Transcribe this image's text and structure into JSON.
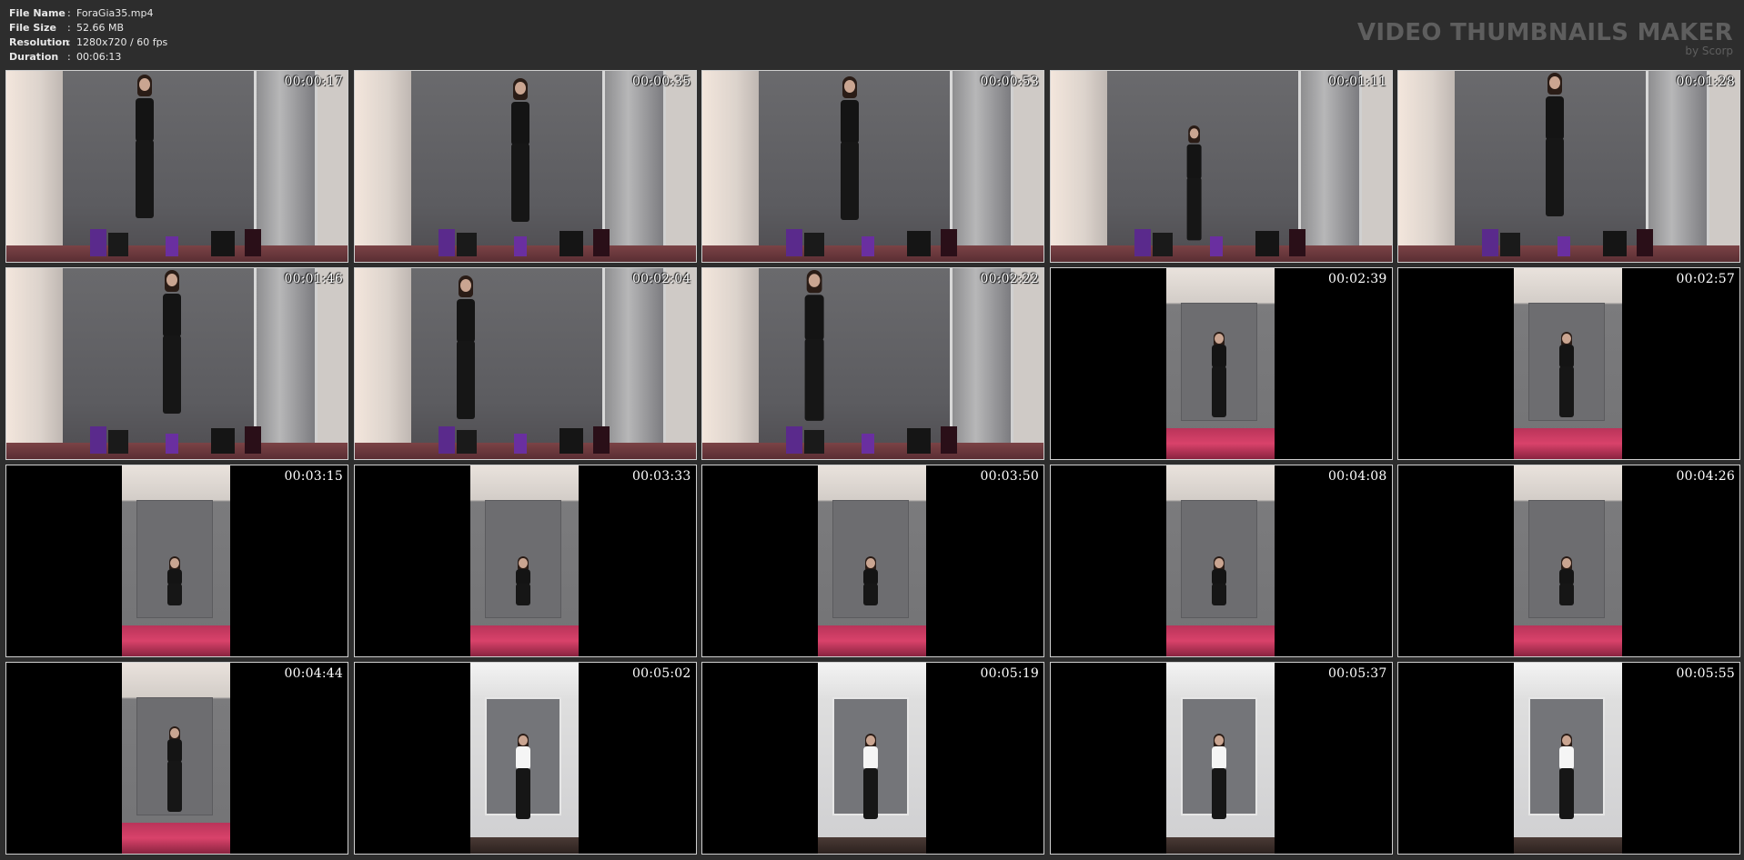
{
  "header": {
    "file_name_label": "File Name",
    "file_name": "ForaGia35.mp4",
    "file_size_label": "File Size",
    "file_size": "52.66 MB",
    "resolution_label": "Resolution",
    "resolution": "1280x720 / 60 fps",
    "duration_label": "Duration",
    "duration": "00:06:13",
    "separator": ":",
    "brand_title": "VIDEO THUMBNAILS MAKER",
    "brand_sub": "by Scorp"
  },
  "thumbnails": [
    {
      "time": "00:00:17",
      "kind": "land"
    },
    {
      "time": "00:00:35",
      "kind": "land"
    },
    {
      "time": "00:00:53",
      "kind": "land"
    },
    {
      "time": "00:01:11",
      "kind": "land"
    },
    {
      "time": "00:01:28",
      "kind": "land"
    },
    {
      "time": "00:01:46",
      "kind": "land"
    },
    {
      "time": "00:02:04",
      "kind": "land"
    },
    {
      "time": "00:02:22",
      "kind": "land"
    },
    {
      "time": "00:02:39",
      "kind": "port"
    },
    {
      "time": "00:02:57",
      "kind": "port"
    },
    {
      "time": "00:03:15",
      "kind": "port"
    },
    {
      "time": "00:03:33",
      "kind": "port"
    },
    {
      "time": "00:03:50",
      "kind": "port"
    },
    {
      "time": "00:04:08",
      "kind": "port"
    },
    {
      "time": "00:04:26",
      "kind": "port"
    },
    {
      "time": "00:04:44",
      "kind": "port"
    },
    {
      "time": "00:05:02",
      "kind": "port-white"
    },
    {
      "time": "00:05:19",
      "kind": "port-white"
    },
    {
      "time": "00:05:37",
      "kind": "port-white"
    },
    {
      "time": "00:05:55",
      "kind": "port-white"
    }
  ]
}
